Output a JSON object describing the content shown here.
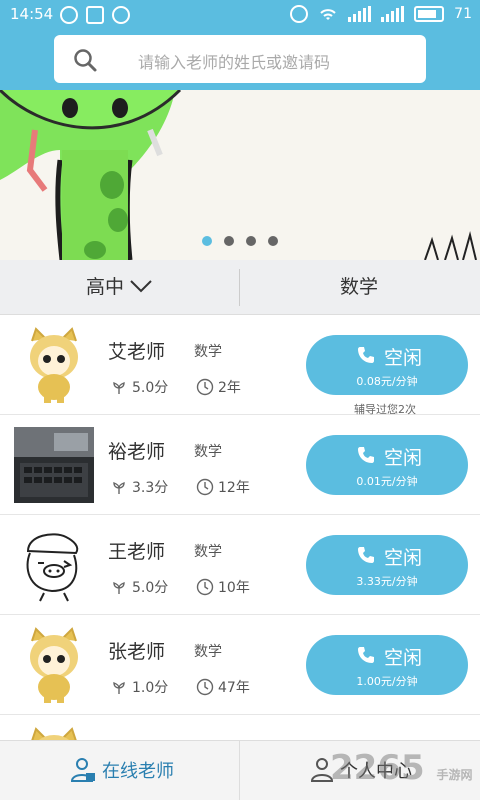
{
  "status_bar": {
    "time": "14:54",
    "battery": "71"
  },
  "search": {
    "placeholder": "请输入老师的姓氏或邀请码"
  },
  "banner": {
    "dot_count": 4,
    "active_dot": 0
  },
  "filter": {
    "grade": "高中",
    "subject": "数学"
  },
  "teachers": [
    {
      "name": "艾老师",
      "subject": "数学",
      "score": "5.0分",
      "years": "2年",
      "status": "空闲",
      "price": "0.08元/分钟",
      "tutored": "辅导过您2次"
    },
    {
      "name": "裕老师",
      "subject": "数学",
      "score": "3.3分",
      "years": "12年",
      "status": "空闲",
      "price": "0.01元/分钟"
    },
    {
      "name": "王老师",
      "subject": "数学",
      "score": "5.0分",
      "years": "10年",
      "status": "空闲",
      "price": "3.33元/分钟"
    },
    {
      "name": "张老师",
      "subject": "数学",
      "score": "1.0分",
      "years": "47年",
      "status": "空闲",
      "price": "1.00元/分钟"
    }
  ],
  "bottom_nav": {
    "online_teachers": "在线老师",
    "personal_center": "个人中心"
  },
  "watermark": {
    "text": "2265",
    "sub": "手游网"
  },
  "colors": {
    "primary": "#5bbde0",
    "active_nav": "#2a7fb0"
  }
}
